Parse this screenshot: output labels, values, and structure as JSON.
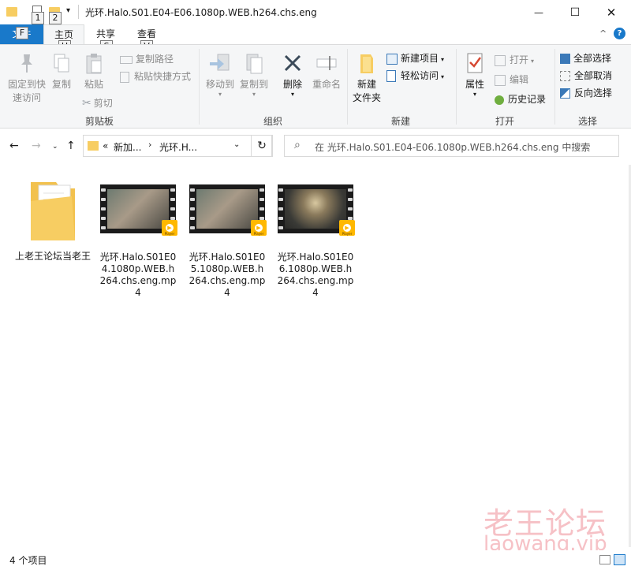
{
  "window": {
    "title": "光环.Halo.S01.E04-E06.1080p.WEB.h264.chs.eng",
    "minimize_glyph": "—",
    "maximize_glyph": "☐",
    "close_glyph": "✕"
  },
  "keytips": {
    "quick1": "1",
    "quick2": "2",
    "file": "F",
    "home": "H",
    "share": "S",
    "view": "V"
  },
  "tabs": {
    "file": "文件",
    "home": "主页",
    "share": "共享",
    "view": "查看"
  },
  "ribbon": {
    "clipboard": {
      "pin_label_1": "固定到快",
      "pin_label_2": "速访问",
      "copy": "复制",
      "paste": "粘贴",
      "copy_path": "复制路径",
      "paste_shortcut": "粘贴快捷方式",
      "cut": "剪切",
      "group": "剪贴板"
    },
    "organize": {
      "move_to": "移动到",
      "copy_to": "复制到",
      "delete": "删除",
      "rename": "重命名",
      "group": "组织"
    },
    "new": {
      "new_folder_1": "新建",
      "new_folder_2": "文件夹",
      "new_item": "新建项目",
      "easy_access": "轻松访问",
      "group": "新建"
    },
    "open": {
      "properties": "属性",
      "open": "打开",
      "edit": "编辑",
      "history": "历史记录",
      "group": "打开"
    },
    "select": {
      "select_all": "全部选择",
      "select_none": "全部取消",
      "invert": "反向选择",
      "group": "选择"
    }
  },
  "address": {
    "overflow": "«",
    "crumb1": "新加...",
    "crumb2": "光环.H...",
    "search_placeholder": "在 光环.Halo.S01.E04-E06.1080p.WEB.h264.chs.eng 中搜索"
  },
  "files": [
    {
      "name": "上老王论坛当老王",
      "type": "folder"
    },
    {
      "name": "光环.Halo.S01E04.1080p.WEB.h264.chs.eng.mp4",
      "type": "video"
    },
    {
      "name": "光环.Halo.S01E05.1080p.WEB.h264.chs.eng.mp4",
      "type": "video"
    },
    {
      "name": "光环.Halo.S01E06.1080p.WEB.h264.chs.eng.mp4",
      "type": "video"
    }
  ],
  "thumb_badge": "Player",
  "status": {
    "count": "4 个项目"
  },
  "watermark": {
    "cn": "老王论坛",
    "en": "laowang.vip"
  },
  "colors": {
    "file_tab": "#1979ca",
    "ribbon_bg": "#f5f6f7",
    "folder_yellow": "#f7cd62",
    "player_badge": "#ffb800",
    "watermark": "#f6c1c6"
  }
}
